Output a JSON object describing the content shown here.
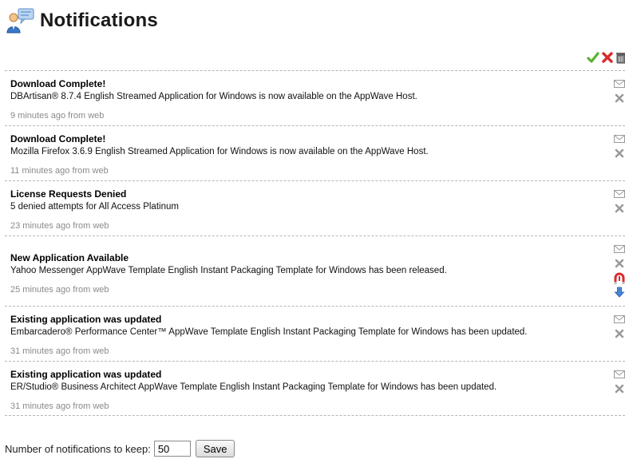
{
  "title": "Notifications",
  "notifications": [
    {
      "title": "Download Complete!",
      "body": "DBArtisan® 8.7.4 English Streamed Application for Windows is now available on the AppWave Host.",
      "time": "9 minutes ago",
      "source": " from web"
    },
    {
      "title": "Download Complete!",
      "body": "Mozilla Firefox 3.6.9 English Streamed Application for Windows is now available on the AppWave Host.",
      "time": "11 minutes ago",
      "source": " from web"
    },
    {
      "title": "License Requests Denied",
      "body": "5 denied attempts for All Access Platinum",
      "time": "23 minutes ago",
      "source": " from web"
    },
    {
      "title": "New Application Available",
      "body": "Yahoo Messenger AppWave Template English Instant Packaging Template for Windows has been released.",
      "time": "25 minutes ago",
      "source": " from web",
      "extra_actions": true
    },
    {
      "title": "Existing application was updated",
      "body": "Embarcadero® Performance Center™ AppWave Template English Instant Packaging Template for Windows has been updated.",
      "time": "31 minutes ago",
      "source": " from web"
    },
    {
      "title": "Existing application was updated",
      "body": "ER/Studio® Business Architect AppWave Template English Instant Packaging Template for Windows has been updated.",
      "time": "31 minutes ago",
      "source": " from web"
    }
  ],
  "footer": {
    "keep_label": "Number of notifications to keep:",
    "keep_value": "50",
    "save_label": "Save"
  },
  "icons": {
    "header": "notifications-people-icon",
    "bulk": [
      "mark-all-read-check-icon",
      "delete-all-x-icon",
      "trash-icon"
    ],
    "item": [
      "envelope-icon",
      "delete-x-icon"
    ],
    "item_extra": [
      "update-magnet-icon",
      "download-arrow-icon"
    ]
  },
  "colors": {
    "check": "#5bb12f",
    "delete_all": "#d82b2b",
    "row_divider": "#b5b5b5",
    "meta_text": "#8a8a8a"
  }
}
